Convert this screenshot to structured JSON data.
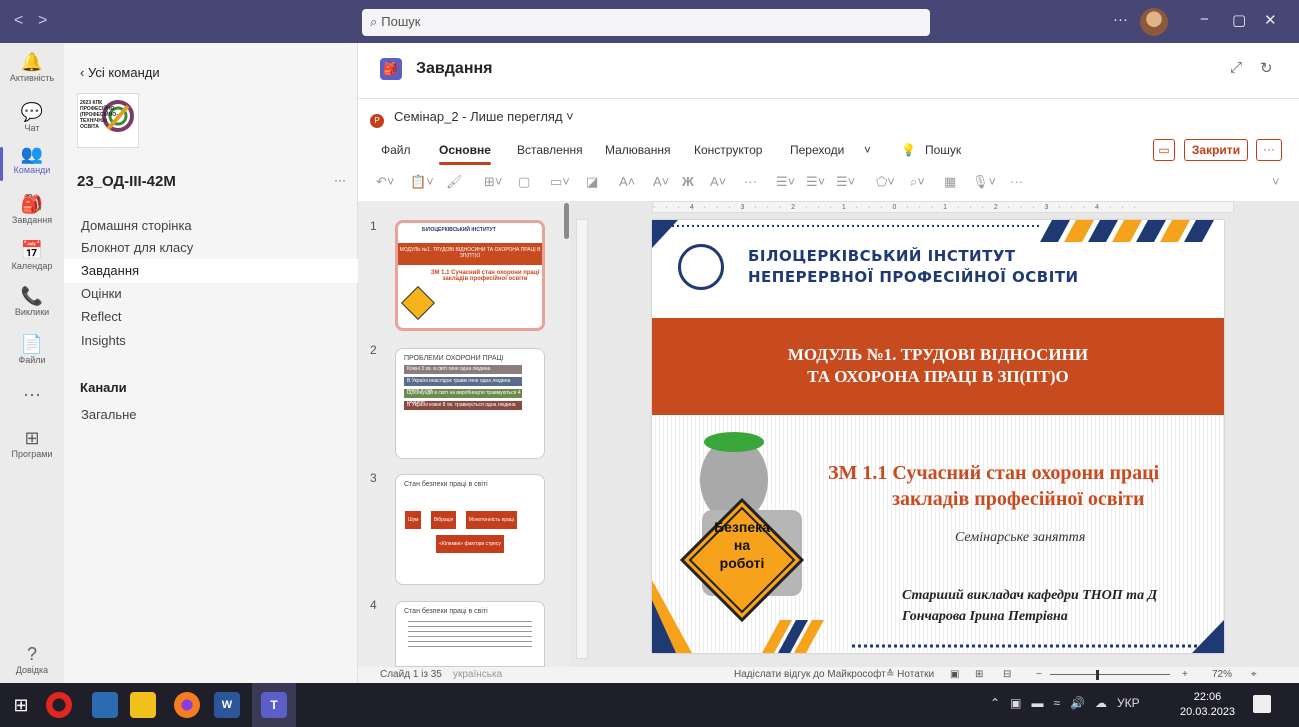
{
  "titlebar": {
    "search_placeholder": "Пошук",
    "more": "···"
  },
  "rail": [
    {
      "label": "Активність",
      "glyph": "🔔"
    },
    {
      "label": "Чат",
      "glyph": "💬"
    },
    {
      "label": "Команди",
      "glyph": "👥"
    },
    {
      "label": "Завдання",
      "glyph": "🎒"
    },
    {
      "label": "Календар",
      "glyph": "📅"
    },
    {
      "label": "Виклики",
      "glyph": "📞"
    },
    {
      "label": "Файли",
      "glyph": "📄"
    },
    {
      "label": "",
      "glyph": "···"
    },
    {
      "label": "Програми",
      "glyph": "⊞"
    },
    {
      "label": "Довідка",
      "glyph": "?"
    }
  ],
  "teampanel": {
    "back": "Усі команди",
    "logo_text": "2023 КПК ПРОФЕСІЙНО (ПРОФЕСІЙНО-ТЕХНІЧНА) ОСВІТА",
    "team_name": "23_ОД-ІІІ-42М",
    "more": "···",
    "nav": [
      "Домашня сторінка",
      "Блокнот для класу",
      "Завдання",
      "Оцінки",
      "Reflect",
      "Insights"
    ],
    "channels_label": "Канали",
    "channels": [
      "Загальне"
    ]
  },
  "app": {
    "title": "Завдання",
    "doc_title": "Семінар_2 - Лише перегляд ˅",
    "tabs": [
      "Файл",
      "Основне",
      "Вставлення",
      "Малювання",
      "Конструктор",
      "Переходи",
      "˅",
      "Пошук"
    ],
    "close_label": "Закрити",
    "more": "···",
    "toolbar": [
      "↶˅",
      "📋˅",
      "🖌",
      "⊞˅",
      "▢",
      "▭˅",
      "◪",
      "A˄",
      "A˅",
      "Ж",
      "A˅",
      "···",
      "☰˅",
      "☰˅",
      "☰˅",
      "⬠˅",
      "⌕˅",
      "▦",
      "🎙˅",
      "···",
      "˅"
    ]
  },
  "thumbnails": [
    {
      "num": "1",
      "title": "МОДУЛЬ №1. ТРУДОВІ ВІДНОСИНИ ТА ОХОРОНА ПРАЦІ В ЗП(ПТ)О",
      "subtitle": "ЗМ 1.1 Сучасний стан охорони праці закладів професійної освіти"
    },
    {
      "num": "2",
      "title": "ПРОБЛЕМИ ОХОРОНИ ПРАЦІ",
      "rows": [
        "Кожні 3 хв. в світі гине одна людина",
        "В Україні внаслідок травм гине одна людина кожні 6 год.",
        "Щосекунди в світі на виробництві травмуються 4 людини",
        "В Україні кожні 8 хв. травмується одна людина"
      ],
      "colors": [
        "#8a7d7b",
        "#5a6b8c",
        "#6b8a4e",
        "#8a4a3f"
      ]
    },
    {
      "num": "3",
      "title": "Стан безпеки праці в світі",
      "boxes": [
        "Шум",
        "Вібрація",
        "Монотонність праці",
        "«Кілеквні» фактори стресу"
      ]
    },
    {
      "num": "4",
      "title": "Стан безпеки праці в світі"
    }
  ],
  "slide": {
    "inst_line1": "БІЛОЦЕРКІВСЬКИЙ ІНСТИТУТ",
    "inst_line2": "НЕПЕРЕРВНОЇ ПРОФЕСІЙНОЇ ОСВІТИ",
    "module_line1": "МОДУЛЬ №1. ТРУДОВІ ВІДНОСИНИ",
    "module_line2": "ТА ОХОРОНА ПРАЦІ В ЗП(ПТ)О",
    "zm_line1": "ЗМ 1.1 Сучасний стан охорони праці",
    "zm_line2": "закладів професійної освіти",
    "seminar": "Семінарське заняття",
    "author_line1": "Старший викладач кафедри ТНОП та Д",
    "author_line2": "Гончарова Ірина Петрівна",
    "sign_text": [
      "Безпека",
      "на",
      "роботі"
    ],
    "ruler": "· · · 4 · · · 3 · · · 2 · · · 1 · · · 0 · · · 1 · · · 2 · · · 3 · · · 4 · · ·"
  },
  "statusbar": {
    "slide": "Слайд 1 із 35",
    "lang": "українська",
    "feedback": "Надіслати відгук до Майкрософт",
    "notes": "≙ Нотатки",
    "zoom": "72%"
  },
  "taskbar": {
    "time": "22:06",
    "date": "20.03.2023",
    "lang": "УКР"
  },
  "colors": {
    "teams": "#464775",
    "accent": "#5b5fc7",
    "ppt": "#c43e1c",
    "band": "#c84a1f"
  }
}
